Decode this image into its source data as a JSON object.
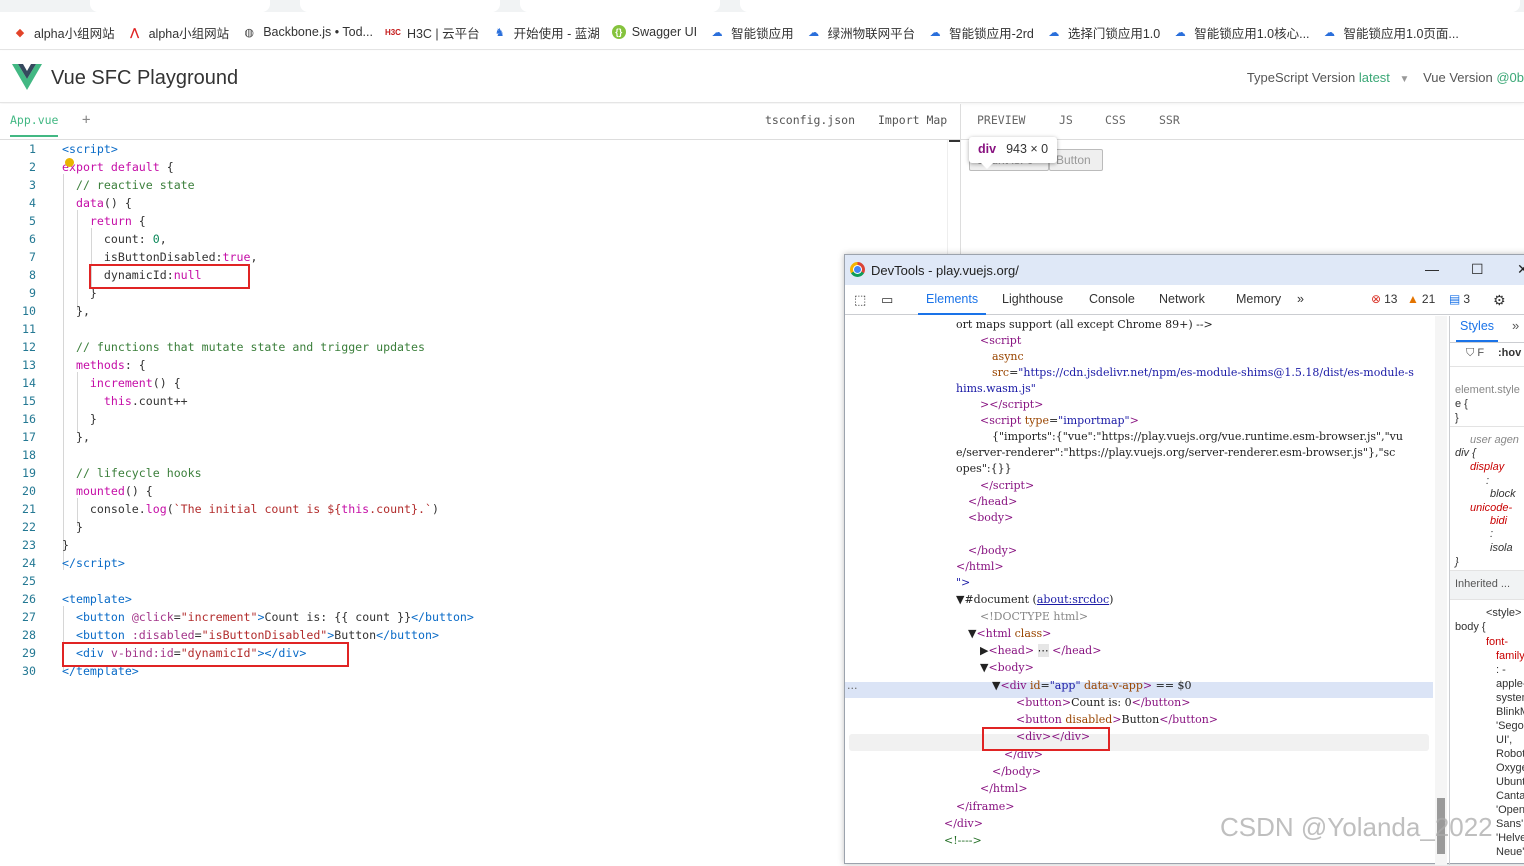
{
  "bookmarks": [
    {
      "icon": "gitlab-icon",
      "label": "alpha小组网站"
    },
    {
      "icon": "antdesign-icon",
      "label": "alpha小组网站"
    },
    {
      "icon": "globe-icon",
      "label": "Backbone.js • Tod..."
    },
    {
      "icon": "h3c-icon",
      "label": "H3C | 云平台"
    },
    {
      "icon": "lanhu-icon",
      "label": "开始使用 - 蓝湖"
    },
    {
      "icon": "swagger-icon",
      "label": "Swagger UI"
    },
    {
      "icon": "cloud-icon",
      "label": "智能锁应用"
    },
    {
      "icon": "cloud-icon",
      "label": "绿洲物联网平台"
    },
    {
      "icon": "cloud-icon",
      "label": "智能锁应用-2rd"
    },
    {
      "icon": "cloud-icon",
      "label": "选择门锁应用1.0"
    },
    {
      "icon": "cloud-icon",
      "label": "智能锁应用1.0核心..."
    },
    {
      "icon": "cloud-icon",
      "label": "智能锁应用1.0页面..."
    }
  ],
  "header": {
    "title": "Vue SFC Playground",
    "ts_label": "TypeScript Version",
    "ts_value": "latest",
    "vue_label": "Vue Version",
    "vue_value": "@0b"
  },
  "editor": {
    "active_tab": "App.vue",
    "add_tab": "+",
    "tsconfig": "tsconfig.json",
    "import_map": "Import Map"
  },
  "preview_tabs": [
    "PREVIEW",
    "JS",
    "CSS",
    "SSR"
  ],
  "code_lines": [
    "1",
    "2",
    "3",
    "4",
    "5",
    "6",
    "7",
    "8",
    "9",
    "10",
    "11",
    "12",
    "13",
    "14",
    "15",
    "16",
    "17",
    "18",
    "19",
    "20",
    "21",
    "22",
    "23",
    "24",
    "25",
    "26",
    "27",
    "28",
    "29",
    "30"
  ],
  "preview": {
    "count_button": "Count is: 0",
    "disabled_button": "Button",
    "tooltip_tag": "div",
    "tooltip_size": "943 × 0"
  },
  "devtools": {
    "window_title": "DevTools - play.vuejs.org/",
    "tabs": [
      "Elements",
      "Lighthouse",
      "Console",
      "Network",
      "Memory"
    ],
    "more": "»",
    "errors": "13",
    "warnings": "21",
    "messages": "3",
    "styles_tab": "Styles",
    "styles_more": "»",
    "filter": "F",
    "hover": ":hov",
    "inherited": "Inherited ..."
  },
  "watermark": "CSDN @Yolanda_2022",
  "colors": {
    "vue_green": "#42b883",
    "red_box": "#e02424",
    "devtools_blue": "#1a73e8"
  }
}
